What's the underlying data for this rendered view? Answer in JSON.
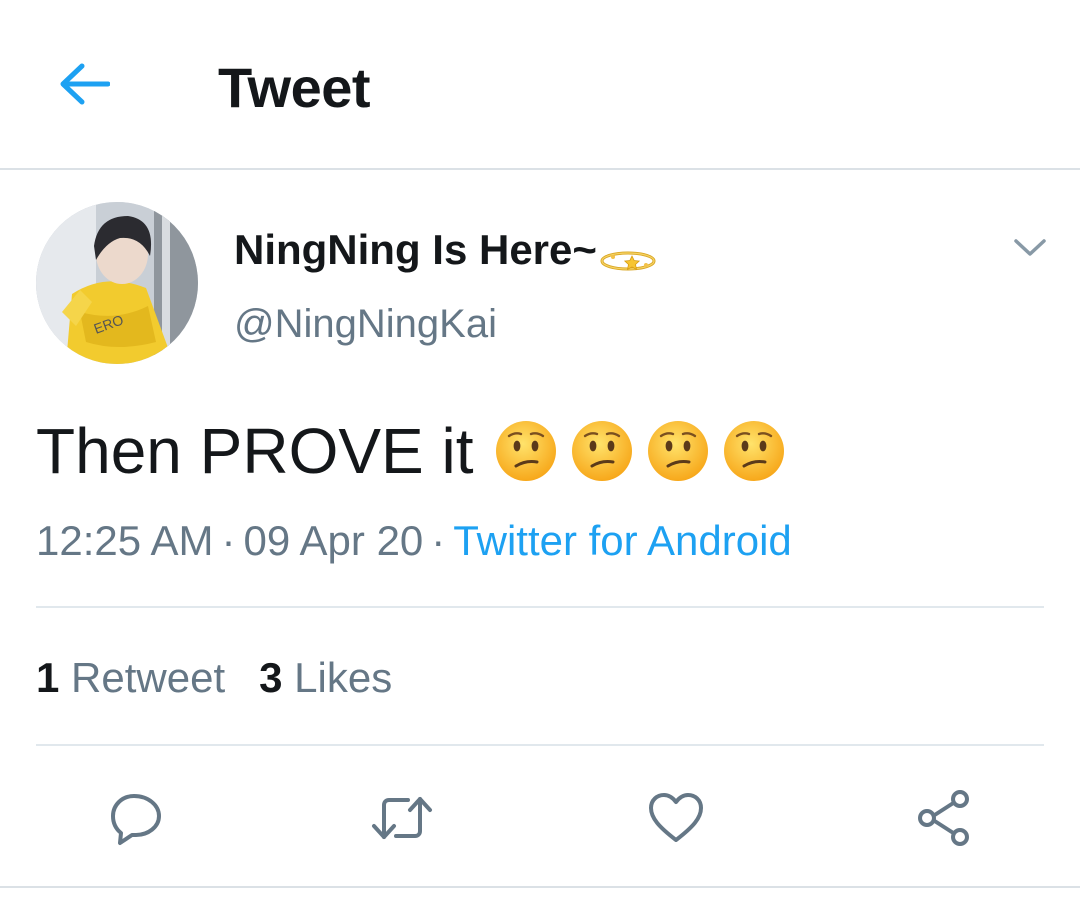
{
  "header": {
    "title": "Tweet",
    "back_icon": "back-arrow-icon",
    "accent_color": "#1da1f2"
  },
  "author": {
    "display_name": "NingNing Is Here~",
    "name_emoji": "halo-icon",
    "handle": "@NingNingKai",
    "avatar": "avatar-photo"
  },
  "tweet": {
    "text": "Then PROVE it",
    "emoji": [
      "confused-face-emoji",
      "confused-face-emoji",
      "confused-face-emoji",
      "confused-face-emoji"
    ],
    "time": "12:25 AM",
    "separator": "·",
    "date": "09 Apr 20",
    "source": "Twitter for Android"
  },
  "stats": {
    "retweets_count": "1",
    "retweets_label": "Retweet",
    "likes_count": "3",
    "likes_label": "Likes"
  },
  "actions": [
    {
      "icon": "reply-icon"
    },
    {
      "icon": "retweet-icon"
    },
    {
      "icon": "like-heart-icon"
    },
    {
      "icon": "share-icon"
    }
  ],
  "colors": {
    "text_primary": "#14171a",
    "text_secondary": "#657786",
    "divider": "#e1e8ed",
    "link": "#1da1f2"
  }
}
